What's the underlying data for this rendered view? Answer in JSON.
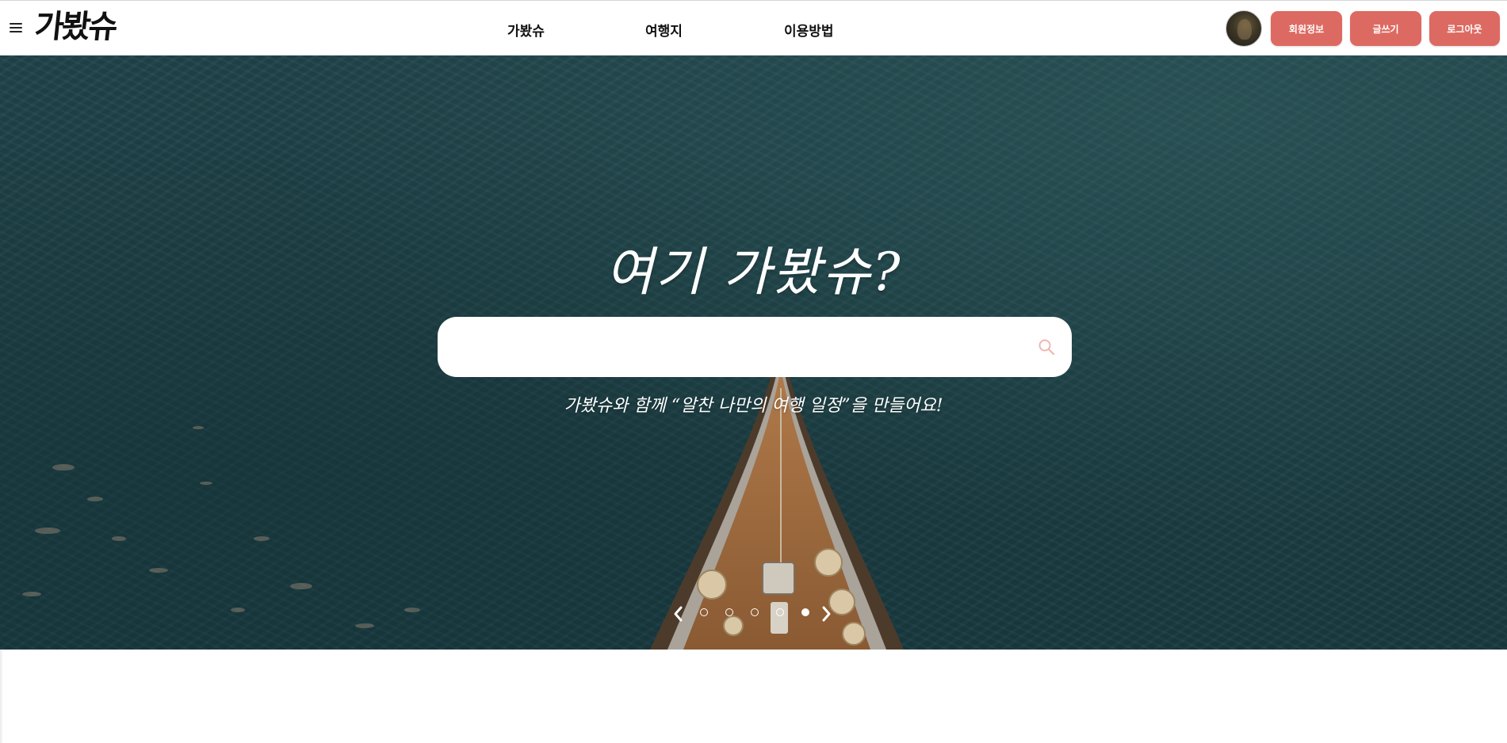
{
  "header": {
    "logo": "가봤슈",
    "nav": [
      {
        "label": "가봤슈"
      },
      {
        "label": "여행지"
      },
      {
        "label": "이용방법"
      }
    ],
    "buttons": {
      "member_info": "회원정보",
      "write": "글쓰기",
      "logout": "로그아웃"
    }
  },
  "hero": {
    "title": "여기 가봤슈?",
    "search": {
      "value": "",
      "placeholder": ""
    },
    "subtitle": "가봤슈와 함께 “알찬 나만의 여행 일정”을 만들어요!",
    "carousel": {
      "total": 5,
      "active_index": 4
    }
  },
  "colors": {
    "accent": "#dd6a62",
    "hero_bg": "#1f4248",
    "search_icon": "#f1b6b0"
  },
  "icons": {
    "menu": "menu-icon",
    "search": "search-icon",
    "prev": "chevron-left-icon",
    "next": "chevron-right-icon"
  }
}
